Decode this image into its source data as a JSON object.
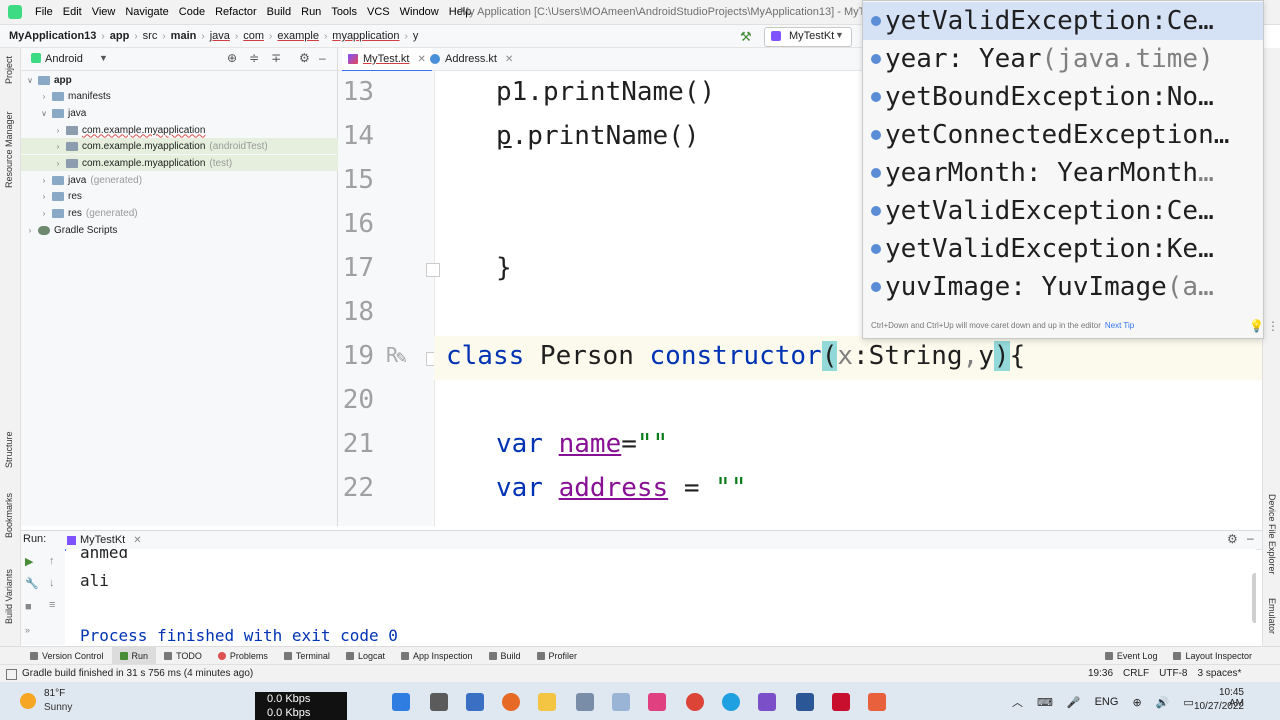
{
  "menubar": {
    "items": [
      "File",
      "Edit",
      "View",
      "Navigate",
      "Code",
      "Refactor",
      "Build",
      "Run",
      "Tools",
      "VCS",
      "Window",
      "Help"
    ],
    "window_title": "My Application [C:\\Users\\MOAmeen\\AndroidStudioProjects\\MyApplication13] - MyTest.kt"
  },
  "breadcrumb": [
    "MyApplication13",
    "app",
    "src",
    "main",
    "java",
    "com",
    "example",
    "myapplication",
    "y"
  ],
  "toolbar": {
    "run_config": "MyTestKt"
  },
  "left_strip": [
    "Project",
    "Resource Manager",
    "Structure",
    "Bookmarks",
    "Build Variants"
  ],
  "right_strip": [
    "Device File Explorer",
    "Emulator"
  ],
  "project": {
    "view": "Android",
    "tree": [
      {
        "label": "app",
        "extra": "",
        "bold": true
      },
      {
        "label": "manifests",
        "extra": ""
      },
      {
        "label": "java",
        "extra": ""
      },
      {
        "label": "com.example.myapplication",
        "extra": ""
      },
      {
        "label": "com.example.myapplication",
        "extra": "(androidTest)"
      },
      {
        "label": "com.example.myapplication",
        "extra": "(test)"
      },
      {
        "label": "java",
        "extra": "(generated)"
      },
      {
        "label": "res",
        "extra": ""
      },
      {
        "label": "res",
        "extra": "(generated)"
      },
      {
        "label": "Gradle Scripts",
        "extra": ""
      }
    ]
  },
  "tabs": [
    "MyTest.kt",
    "Address.kt"
  ],
  "editor": {
    "line_numbers": [
      "13",
      "14",
      "15",
      "16",
      "17",
      "18",
      "19",
      "20",
      "21",
      "22"
    ],
    "lines": {
      "l13": "p1.printName()",
      "l14_p": "p",
      "l14_rest": ".printName()",
      "l17": "}",
      "l19_kw": "class",
      "l19_name": " Person ",
      "l19_ctor": "constructor",
      "l19_open": "(",
      "l19_x": "x",
      "l19_type": ":String",
      "l19_comma": ",",
      "l19_y": "y",
      "l19_close": ")",
      "l19_brace": "{",
      "l21_kw": "var ",
      "l21_prop": "name",
      "l21_eq": "=",
      "l21_str": "\"\"",
      "l22_kw": "var ",
      "l22_prop": "address",
      "l22_eq": " = ",
      "l22_str": "\"\""
    }
  },
  "completion": {
    "items": [
      {
        "name": "yetValidException: ",
        "type": "Ce…"
      },
      {
        "name": "year: Year ",
        "type": "(java.time)"
      },
      {
        "name": "yetBoundException: ",
        "type": "No…"
      },
      {
        "name": "yetConnectedException…",
        "type": ""
      },
      {
        "name": "yearMonth: YearMonth ",
        "type": "…"
      },
      {
        "name": "yetValidException: ",
        "type": "Ce…"
      },
      {
        "name": "yetValidException: ",
        "type": "Ke…"
      },
      {
        "name": "yuvImage: YuvImage ",
        "type": "(a…"
      }
    ],
    "hint": "Ctrl+Down and Ctrl+Up will move caret down and up in the editor",
    "hint_link": "Next Tip"
  },
  "run_panel": {
    "title": "Run:",
    "tab": "MyTestKt",
    "output": [
      "ahmed",
      "ali",
      "",
      "Process finished with exit code 0"
    ]
  },
  "bottom_tabs": [
    "Version Control",
    "Run",
    "TODO",
    "Problems",
    "Terminal",
    "Logcat",
    "App Inspection",
    "Build",
    "Profiler"
  ],
  "bottom_tabs_right": [
    "Event Log",
    "Layout Inspector"
  ],
  "status": {
    "message": "Gradle build finished in 31 s 756 ms (4 minutes ago)",
    "position": "19:36",
    "line_sep": "CRLF",
    "encoding": "UTF-8",
    "indent": "3 spaces*"
  },
  "taskbar": {
    "temp": "81°F",
    "weather": "Sunny",
    "net_up": "0.0 Kbps",
    "net_down": "0.0 Kbps",
    "lang": "ENG",
    "time": "10:45 AM",
    "date": "10/27/2022"
  }
}
